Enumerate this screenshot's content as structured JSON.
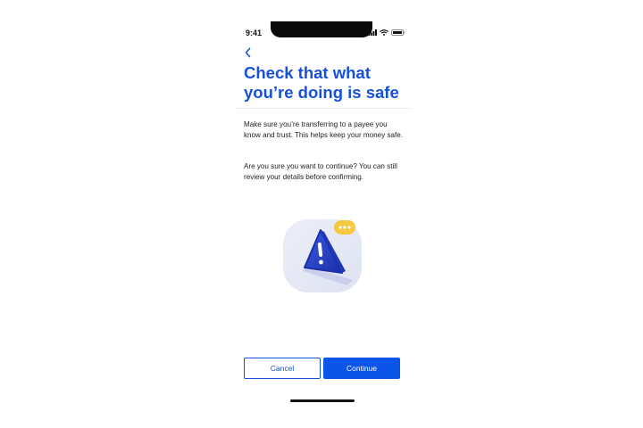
{
  "status_bar": {
    "time": "9:41",
    "icons": [
      "signal-icon",
      "wifi-icon",
      "battery-icon"
    ]
  },
  "nav": {
    "back_icon": "chevron-left-icon"
  },
  "header": {
    "title": "Check that what you’re doing is safe"
  },
  "body": {
    "paragraph_1": "Make sure you’re transferring to a payee you know and trust. This helps keep your money safe.",
    "paragraph_2": "Are you sure you want to continue? You can still review your details before confirming."
  },
  "illustration": {
    "icon": "warning-triangle-icon",
    "badge_icon": "ellipsis-bubble-icon"
  },
  "actions": {
    "cancel_label": "Cancel",
    "continue_label": "Continue"
  },
  "colors": {
    "accent": "#1652d9",
    "primary_button": "#0b55e8",
    "badge": "#f5c842"
  }
}
